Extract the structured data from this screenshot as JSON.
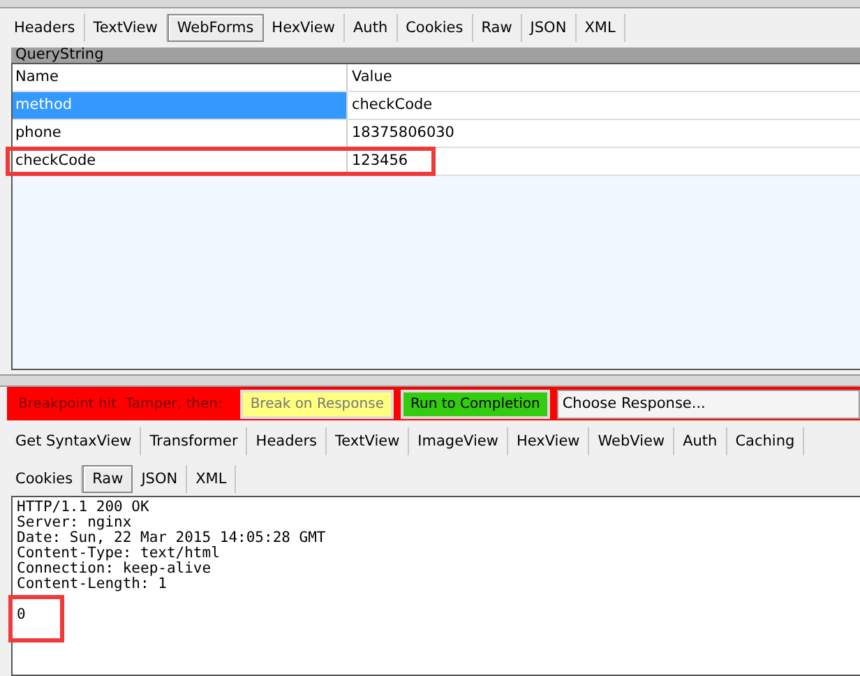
{
  "request_tabs": [
    {
      "label": "Headers",
      "selected": false
    },
    {
      "label": "TextView",
      "selected": false
    },
    {
      "label": "WebForms",
      "selected": true
    },
    {
      "label": "HexView",
      "selected": false
    },
    {
      "label": "Auth",
      "selected": false
    },
    {
      "label": "Cookies",
      "selected": false
    },
    {
      "label": "Raw",
      "selected": false
    },
    {
      "label": "JSON",
      "selected": false
    },
    {
      "label": "XML",
      "selected": false
    }
  ],
  "query_string": {
    "title": "QueryString",
    "columns": [
      "Name",
      "Value"
    ],
    "rows": [
      {
        "name": "method",
        "value": "checkCode",
        "selected": true,
        "annotated": false
      },
      {
        "name": "phone",
        "value": "18375806030",
        "selected": false,
        "annotated": false
      },
      {
        "name": "checkCode",
        "value": "123456",
        "selected": false,
        "annotated": true
      }
    ]
  },
  "breakpoint_bar": {
    "message": "Breakpoint hit. Tamper, then:",
    "buttons": [
      {
        "label": "Break on Response",
        "kind": "yellow"
      },
      {
        "label": "Run to Completion",
        "kind": "green"
      }
    ],
    "dropdown": "Choose Response..."
  },
  "response_tabs": [
    [
      {
        "label": "Get SyntaxView",
        "selected": false
      },
      {
        "label": "Transformer",
        "selected": false
      },
      {
        "label": "Headers",
        "selected": false
      },
      {
        "label": "TextView",
        "selected": false
      },
      {
        "label": "ImageView",
        "selected": false
      },
      {
        "label": "HexView",
        "selected": false
      },
      {
        "label": "WebView",
        "selected": false
      },
      {
        "label": "Auth",
        "selected": false
      },
      {
        "label": "Caching",
        "selected": false
      }
    ],
    [
      {
        "label": "Cookies",
        "selected": false
      },
      {
        "label": "Raw",
        "selected": true
      },
      {
        "label": "JSON",
        "selected": false
      },
      {
        "label": "XML",
        "selected": false
      }
    ]
  ],
  "response": {
    "lines": [
      "HTTP/1.1 200 OK",
      "Server: nginx",
      "Date: Sun, 22 Mar 2015 14:05:28 GMT",
      "Content-Type: text/html",
      "Connection: keep-alive",
      "Content-Length: 1"
    ],
    "body": "0",
    "body_annotated": true
  }
}
